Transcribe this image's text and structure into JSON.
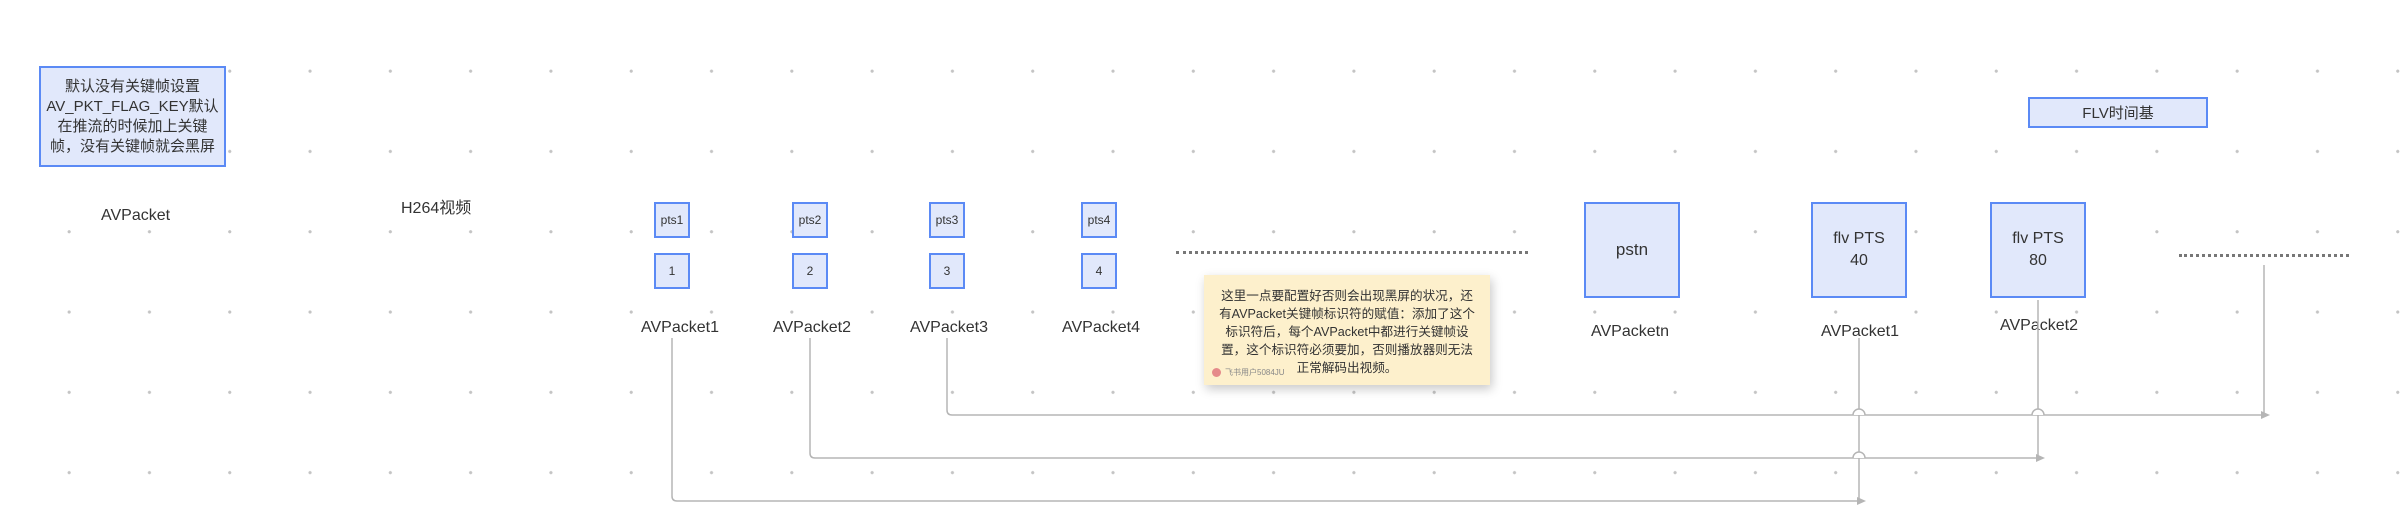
{
  "note_box": {
    "text": "默认没有关键帧设置AV_PKT_FLAG_KEY默认在推流的时候加上关键帧，没有关键帧就会黑屏"
  },
  "labels": {
    "avpacket": "AVPacket",
    "h264": "H264视频",
    "flv_timebase": "FLV时间基"
  },
  "packets": [
    {
      "pts": "pts1",
      "index": "1",
      "label": "AVPacket1"
    },
    {
      "pts": "pts2",
      "index": "2",
      "label": "AVPacket2"
    },
    {
      "pts": "pts3",
      "index": "3",
      "label": "AVPacket3"
    },
    {
      "pts": "pts4",
      "index": "4",
      "label": "AVPacket4"
    }
  ],
  "pstn": {
    "text": "pstn",
    "label": "AVPacketn"
  },
  "flv_packets": [
    {
      "line1": "flv PTS",
      "line2": "40",
      "label": "AVPacket1"
    },
    {
      "line1": "flv PTS",
      "line2": "80",
      "label": "AVPacket2"
    }
  ],
  "sticky_note": {
    "text": "这里一点要配置好否则会出现黑屏的状况，还有AVPacket关键帧标识符的赋值：添加了这个标识符后，每个AVPacket中都进行关键帧设置，这个标识符必须要加，否则播放器则无法正常解码出视频。",
    "author": "飞书用户5084JU"
  },
  "colors": {
    "node_fill": "#e1e8fb",
    "node_border": "#5b8af5",
    "connector": "#b5b5b5",
    "sticky": "#fdf0cc"
  }
}
